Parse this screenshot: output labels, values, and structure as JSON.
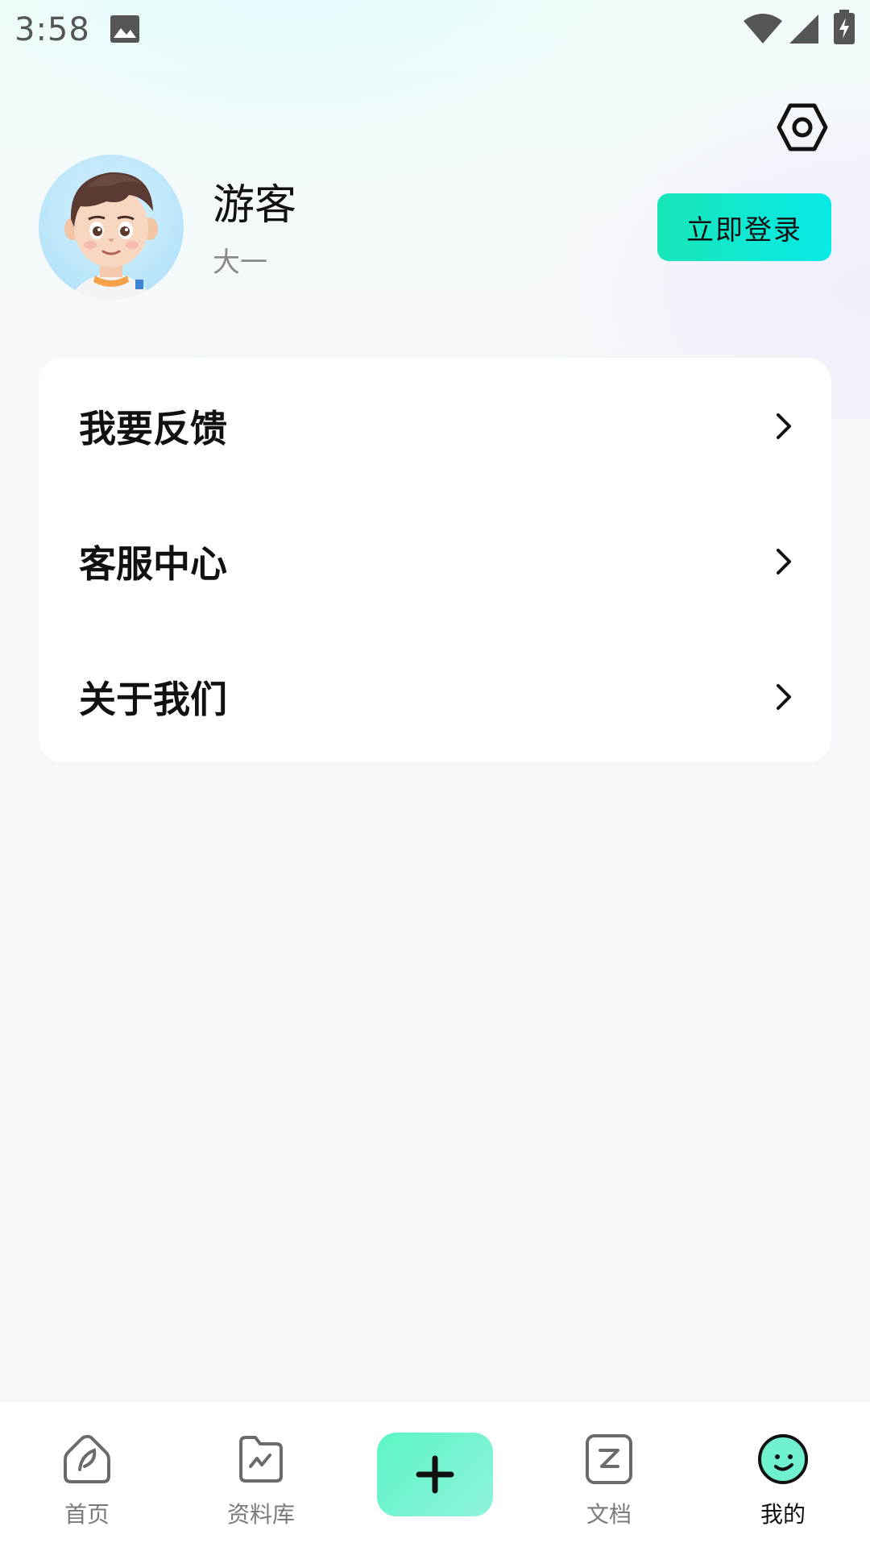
{
  "status_bar": {
    "time": "3:58"
  },
  "profile": {
    "username": "游客",
    "grade": "大一",
    "login_button": "立即登录"
  },
  "menu": {
    "items": [
      {
        "label": "我要反馈"
      },
      {
        "label": "客服中心"
      },
      {
        "label": "关于我们"
      }
    ]
  },
  "nav": {
    "items": [
      {
        "label": "首页",
        "icon": "home-leaf-icon"
      },
      {
        "label": "资料库",
        "icon": "folder-icon"
      },
      {
        "label": "",
        "icon": "plus-icon"
      },
      {
        "label": "文档",
        "icon": "document-icon"
      },
      {
        "label": "我的",
        "icon": "smiley-face-icon",
        "active": true
      }
    ]
  },
  "colors": {
    "accent": "#19e6b8",
    "accent_end": "#08eae8",
    "text_primary": "#111111",
    "text_secondary": "#8a8a8a"
  }
}
